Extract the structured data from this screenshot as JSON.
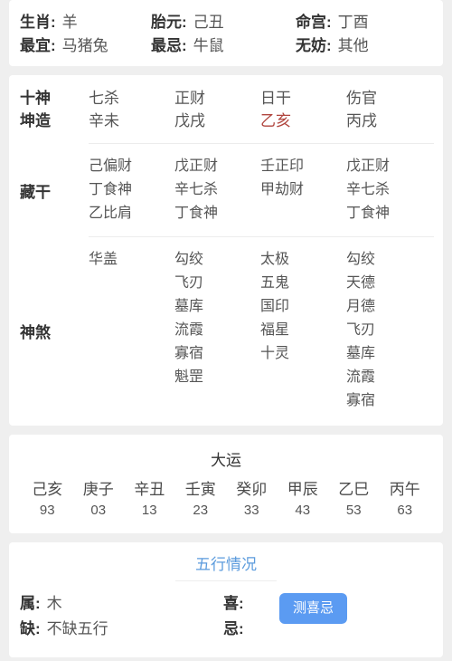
{
  "summary": {
    "rows": [
      [
        {
          "label": "生肖:",
          "value": "羊"
        },
        {
          "label": "胎元:",
          "value": "己丑"
        },
        {
          "label": "命宫:",
          "value": "丁酉"
        }
      ],
      [
        {
          "label": "最宜:",
          "value": "马猪兔"
        },
        {
          "label": "最忌:",
          "value": "牛鼠"
        },
        {
          "label": "无妨:",
          "value": "其他"
        }
      ]
    ]
  },
  "pillars": {
    "shishen_label": "十神",
    "kunzao_label": "坤造",
    "canggan_label": "藏干",
    "shensha_label": "神煞",
    "shishen": [
      "七杀",
      "正财",
      "日干",
      "伤官"
    ],
    "kunzao": [
      {
        "text": "辛未",
        "highlight": false
      },
      {
        "text": "戊戌",
        "highlight": false
      },
      {
        "text": "乙亥",
        "highlight": true
      },
      {
        "text": "丙戌",
        "highlight": false
      }
    ],
    "canggan": [
      [
        "己偏财",
        "丁食神",
        "乙比肩"
      ],
      [
        "戊正财",
        "辛七杀",
        "丁食神"
      ],
      [
        "壬正印",
        "甲劫财"
      ],
      [
        "戊正财",
        "辛七杀",
        "丁食神"
      ]
    ],
    "shensha": [
      [
        "华盖"
      ],
      [
        "勾绞",
        "飞刃",
        "墓库",
        "流霞",
        "寡宿",
        "魁罡"
      ],
      [
        "太极",
        "五鬼",
        "国印",
        "福星",
        "十灵"
      ],
      [
        "勾绞",
        "天德",
        "月德",
        "飞刃",
        "墓库",
        "流霞",
        "寡宿"
      ]
    ]
  },
  "dayun": {
    "title": "大运",
    "items": [
      {
        "ganzhi": "己亥",
        "age": "93"
      },
      {
        "ganzhi": "庚子",
        "age": "03"
      },
      {
        "ganzhi": "辛丑",
        "age": "13"
      },
      {
        "ganzhi": "壬寅",
        "age": "23"
      },
      {
        "ganzhi": "癸卯",
        "age": "33"
      },
      {
        "ganzhi": "甲辰",
        "age": "43"
      },
      {
        "ganzhi": "乙巳",
        "age": "53"
      },
      {
        "ganzhi": "丙午",
        "age": "63"
      }
    ]
  },
  "wuxing": {
    "title": "五行情况",
    "shu_label": "属:",
    "shu_value": "木",
    "que_label": "缺:",
    "que_value": "不缺五行",
    "xi_label": "喜:",
    "xi_value": "",
    "ji_label": "忌:",
    "ji_value": "",
    "button_label": "测喜忌"
  },
  "colors": {
    "page_bg": "#efefef",
    "card_bg": "#ffffff",
    "accent_blue": "#5b9bf2",
    "title_blue": "#5b9bdd",
    "highlight_red": "#b0453e",
    "text": "#333333"
  }
}
